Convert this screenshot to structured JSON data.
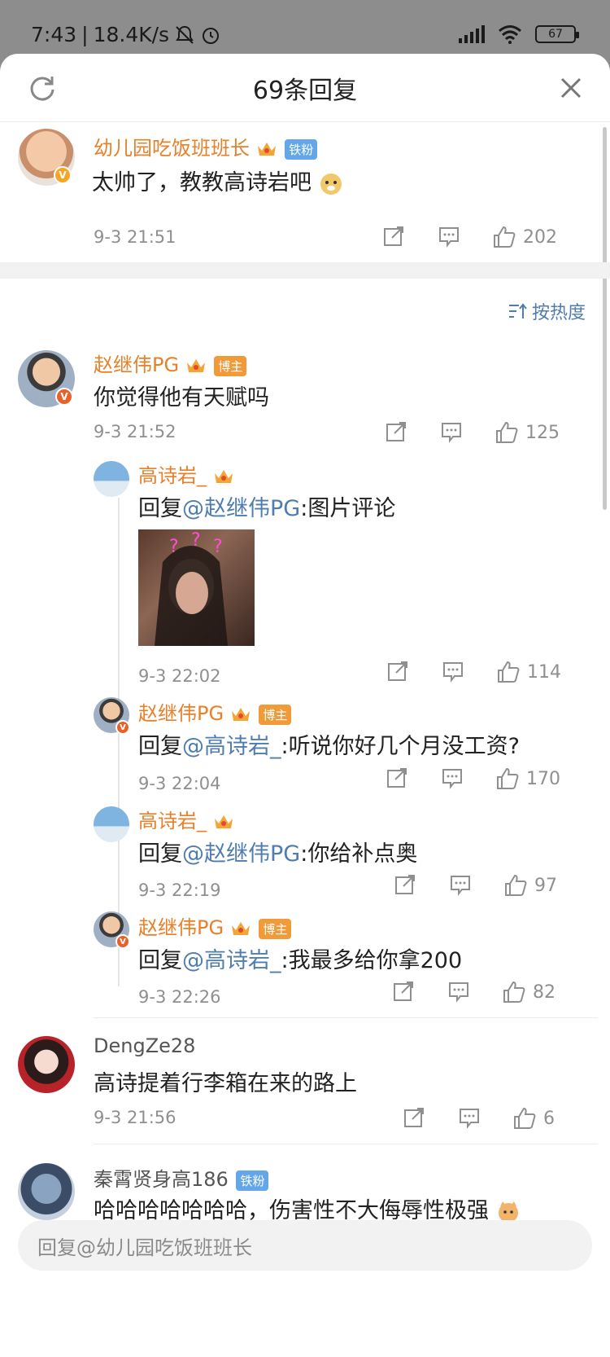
{
  "status_bar": {
    "time": "7:43",
    "speed": "18.4K/s",
    "battery": "67"
  },
  "header": {
    "title": "69条回复"
  },
  "main_comment": {
    "username": "幼儿园吃饭班班长",
    "tag": "铁粉",
    "text": "太帅了，教教高诗岩吧",
    "time": "9-3 21:51",
    "likes": "202"
  },
  "sort": {
    "label": "按热度"
  },
  "comments": [
    {
      "username": "赵继伟PG",
      "tag": "博主",
      "text": "你觉得他有天赋吗",
      "time": "9-3 21:52",
      "likes": "125"
    },
    {
      "username": "DengZe28",
      "text": "高诗提着行李箱在来的路上",
      "time": "9-3 21:56",
      "likes": "6"
    },
    {
      "username": "秦霄贤身高186",
      "tag": "铁粉",
      "text": "哈哈哈哈哈哈哈，伤害性不大侮辱性极强"
    }
  ],
  "replies": [
    {
      "username": "高诗岩_",
      "reply_prefix": "回复",
      "mention": "@赵继伟PG",
      "text": ":图片评论",
      "time": "9-3 22:02",
      "likes": "114"
    },
    {
      "username": "赵继伟PG",
      "tag": "博主",
      "reply_prefix": "回复",
      "mention": "@高诗岩_",
      "text": ":听说你好几个月没工资?",
      "time": "9-3 22:04",
      "likes": "170"
    },
    {
      "username": "高诗岩_",
      "reply_prefix": "回复",
      "mention": "@赵继伟PG",
      "text": ":你给补点奥",
      "time": "9-3 22:19",
      "likes": "97"
    },
    {
      "username": "赵继伟PG",
      "tag": "博主",
      "reply_prefix": "回复",
      "mention": "@高诗岩_",
      "text": ":我最多给你拿200",
      "time": "9-3 22:26",
      "likes": "82"
    }
  ],
  "reply_bar": {
    "placeholder": "回复@幼儿园吃饭班班长"
  },
  "colors": {
    "username": "#e8802a",
    "mention": "#507daf",
    "muted": "#8f8f8f"
  }
}
